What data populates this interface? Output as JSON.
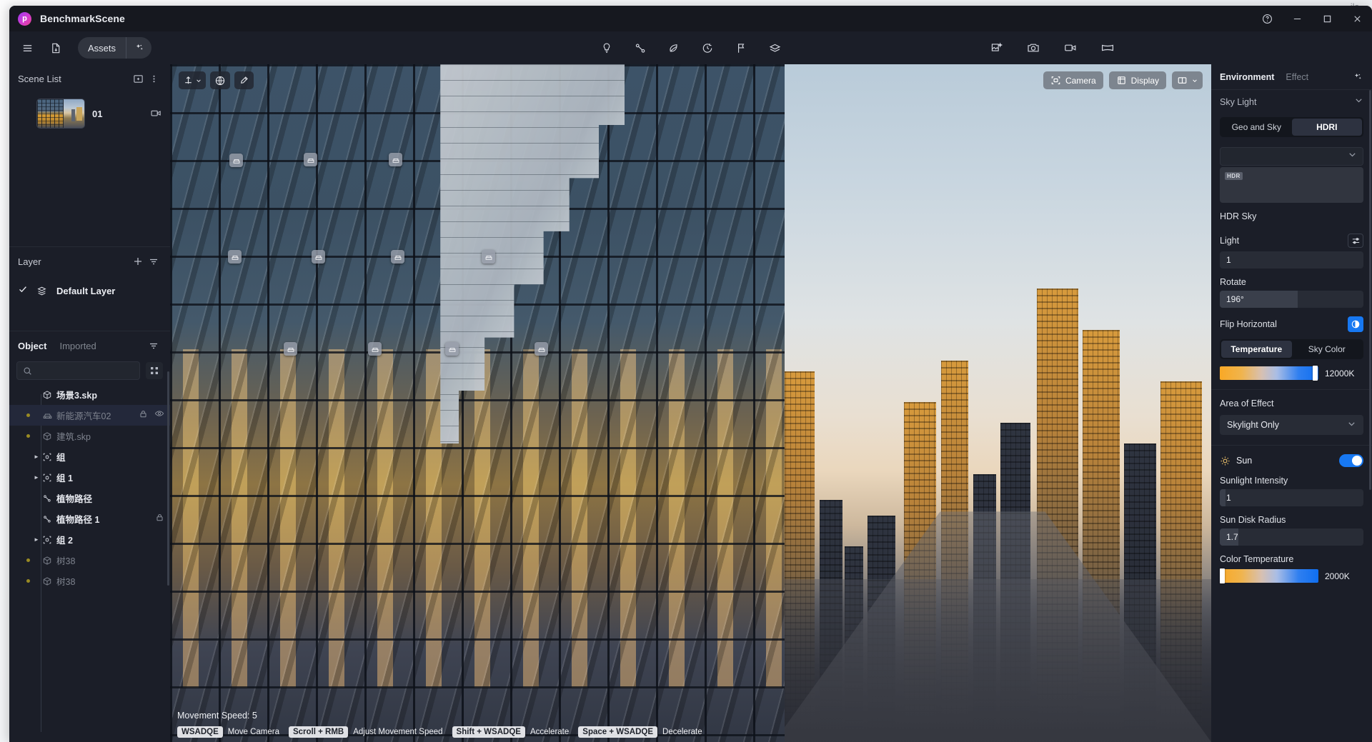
{
  "desktop": {
    "bg_text": "ils"
  },
  "window": {
    "title": "BenchmarkScene",
    "logo_glyph": "p",
    "controls": {
      "help": "help-circle",
      "minimize": "minimize",
      "maximize": "maximize",
      "close": "close"
    }
  },
  "toolbar": {
    "menu_icon": "hamburger-menu-icon",
    "import_icon": "file-import-icon",
    "assets_label": "Assets",
    "assets_ai_icon": "sparkle-icon",
    "center_tools": [
      {
        "name": "light-icon",
        "title": "Light"
      },
      {
        "name": "path-icon",
        "title": "Path"
      },
      {
        "name": "leaf-icon",
        "title": "Vegetation"
      },
      {
        "name": "clock-icon",
        "title": "Animation"
      },
      {
        "name": "flag-icon",
        "title": "Marker"
      },
      {
        "name": "terrain-icon",
        "title": "Terrain"
      }
    ],
    "right_tools": [
      {
        "name": "magic-image-icon",
        "title": "AI Render"
      },
      {
        "name": "camera-icon",
        "title": "Snapshot"
      },
      {
        "name": "video-camera-icon",
        "title": "Video"
      },
      {
        "name": "panorama-icon",
        "title": "Panorama"
      }
    ]
  },
  "left_panel": {
    "scene": {
      "title": "Scene List",
      "add_icon": "add-scene-icon",
      "more_icon": "more-vertical-icon",
      "items": [
        {
          "label": "01",
          "camera_icon": "camera-switch-icon"
        }
      ]
    },
    "layer": {
      "title": "Layer",
      "add_icon": "plus-icon",
      "filter_icon": "filter-icon",
      "items": [
        {
          "label": "Default Layer",
          "checked": true,
          "layer_icon": "layers-icon"
        }
      ]
    },
    "object": {
      "tabs": [
        {
          "label": "Object",
          "active": true
        },
        {
          "label": "Imported",
          "active": false
        }
      ],
      "filter_icon": "filter-icon",
      "search": {
        "placeholder": "",
        "value": "",
        "icon": "search-icon"
      },
      "grid_icon": "grid-view-icon",
      "tree": [
        {
          "label": "场景3.skp",
          "icon": "cube-icon",
          "indent": 0,
          "dim": false,
          "dot": false,
          "caret": false,
          "sel": false,
          "lock": false,
          "eye": false
        },
        {
          "label": "新能源汽车02",
          "icon": "car-icon",
          "indent": 1,
          "dim": true,
          "dot": true,
          "caret": false,
          "sel": true,
          "lock": true,
          "eye": true
        },
        {
          "label": "建筑.skp",
          "icon": "cube-icon",
          "indent": 1,
          "dim": true,
          "dot": true,
          "caret": false,
          "sel": false,
          "lock": false,
          "eye": false
        },
        {
          "label": "组",
          "icon": "group-icon",
          "indent": 1,
          "dim": false,
          "dot": false,
          "caret": true,
          "sel": false,
          "lock": false,
          "eye": false
        },
        {
          "label": "组 1",
          "icon": "group-icon",
          "indent": 1,
          "dim": false,
          "dot": false,
          "caret": true,
          "sel": false,
          "lock": false,
          "eye": false
        },
        {
          "label": "植物路径",
          "icon": "path-icon",
          "indent": 1,
          "dim": false,
          "dot": false,
          "caret": false,
          "sel": false,
          "lock": false,
          "eye": false
        },
        {
          "label": "植物路径 1",
          "icon": "path-icon",
          "indent": 1,
          "dim": false,
          "dot": false,
          "caret": false,
          "sel": false,
          "lock": true,
          "eye": false
        },
        {
          "label": "组 2",
          "icon": "group-icon",
          "indent": 1,
          "dim": false,
          "dot": false,
          "caret": true,
          "sel": false,
          "lock": false,
          "eye": false
        },
        {
          "label": "树38",
          "icon": "cube-icon",
          "indent": 1,
          "dim": true,
          "dot": true,
          "caret": false,
          "sel": false,
          "lock": false,
          "eye": false
        },
        {
          "label": "树38",
          "icon": "cube-icon",
          "indent": 1,
          "dim": true,
          "dot": true,
          "caret": false,
          "sel": false,
          "lock": false,
          "eye": false
        }
      ]
    }
  },
  "viewport": {
    "left_tools": [
      {
        "name": "transform-gizmo-icon"
      },
      {
        "name": "globe-icon"
      },
      {
        "name": "eyedropper-icon"
      }
    ],
    "right_buttons": [
      {
        "label": "Camera",
        "icon": "camera-frame-icon"
      },
      {
        "label": "Display",
        "icon": "cube-wire-icon"
      },
      {
        "label": "",
        "icon": "layout-split-icon"
      }
    ],
    "pin_icon": "sofa-pin-icon",
    "movement_speed_label": "Movement Speed: 5",
    "hints": [
      {
        "key": "WSADQE",
        "action": "Move Camera"
      },
      {
        "key": "Scroll + RMB",
        "action": "Adjust Movement Speed"
      },
      {
        "key": "Shift + WSADQE",
        "action": "Accelerate"
      },
      {
        "key": "Space + WSADQE",
        "action": "Decelerate"
      }
    ]
  },
  "right_panel": {
    "tabs": [
      {
        "label": "Environment",
        "active": true
      },
      {
        "label": "Effect",
        "active": false
      }
    ],
    "ai_icon": "sparkle-icon",
    "sky_light": {
      "title": "Sky Light",
      "chevron_icon": "chevron-down-icon",
      "mode_segments": [
        {
          "label": "Geo and Sky",
          "on": false
        },
        {
          "label": "HDRI",
          "on": true
        }
      ],
      "hdri_select_value": "",
      "hdr_badge": "HDR",
      "hdr_sky_label": "HDR Sky",
      "light": {
        "label": "Light",
        "value": "1",
        "settings_icon": "sliders-icon"
      },
      "rotate": {
        "label": "Rotate",
        "value": "196°",
        "fill_pct": 54
      },
      "flip_horizontal": {
        "label": "Flip Horizontal",
        "enabled": true,
        "icon": "contrast-icon"
      },
      "color_segments": [
        {
          "label": "Temperature",
          "on": true
        },
        {
          "label": "Sky Color",
          "on": false
        }
      ],
      "temperature": {
        "value": "12000K",
        "knob_pct": 94
      },
      "area_of_effect": {
        "label": "Area of Effect",
        "value": "Skylight Only",
        "chevron_icon": "chevron-down-icon"
      }
    },
    "sun": {
      "label": "Sun",
      "icon": "sun-icon",
      "enabled": true,
      "sunlight_intensity": {
        "label": "Sunlight Intensity",
        "value": "1",
        "fill_pct": 4
      },
      "sun_disk_radius": {
        "label": "Sun Disk Radius",
        "value": "1.7",
        "fill_pct": 13
      },
      "color_temperature": {
        "label": "Color Temperature",
        "value": "2000K",
        "knob_pct": 1
      }
    }
  },
  "colors": {
    "accent_blue": "#1778f2",
    "panel_bg": "#1b1e28",
    "titlebar_bg": "#16181f",
    "brand_gradient_start": "#9a3bf0",
    "brand_gradient_end": "#e8458f",
    "dot_yellow": "#9a8b23"
  }
}
